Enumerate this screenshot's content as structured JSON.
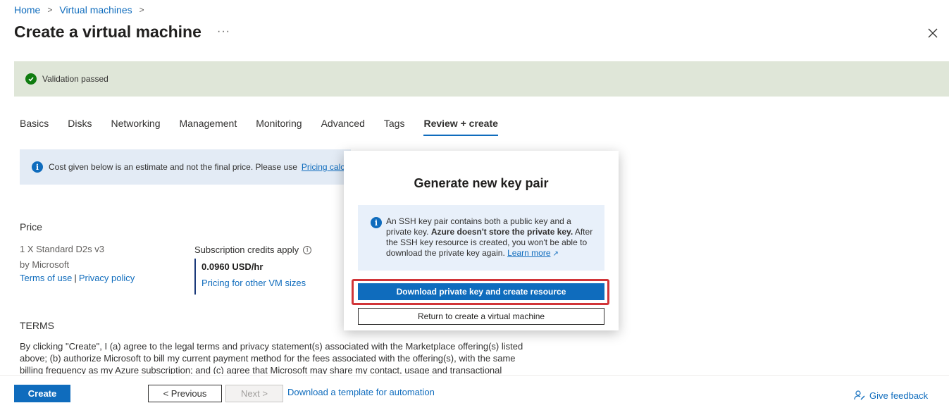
{
  "breadcrumb": {
    "home": "Home",
    "virtual_machines": "Virtual machines"
  },
  "header": {
    "title": "Create a virtual machine",
    "more": "···"
  },
  "validation": {
    "text": "Validation passed"
  },
  "tabs": [
    {
      "label": "Basics"
    },
    {
      "label": "Disks"
    },
    {
      "label": "Networking"
    },
    {
      "label": "Management"
    },
    {
      "label": "Monitoring"
    },
    {
      "label": "Advanced"
    },
    {
      "label": "Tags"
    },
    {
      "label": "Review + create"
    }
  ],
  "info_bar": {
    "text": "Cost given below is an estimate and not the final price. Please use",
    "link": "Pricing calcu"
  },
  "price": {
    "label": "Price",
    "vm_size": "1 X Standard D2s v3",
    "publisher": "by Microsoft",
    "terms_link": "Terms of use",
    "privacy_link": "Privacy policy",
    "separator": "|",
    "subscription_credits": "Subscription credits apply",
    "value": "0.0960 USD/hr",
    "other_sizes_link": "Pricing for other VM sizes"
  },
  "terms": {
    "label": "TERMS",
    "text": "By clicking \"Create\", I (a) agree to the legal terms and privacy statement(s) associated with the Marketplace offering(s) listed above; (b) authorize Microsoft to bill my current payment method for the fees associated with the offering(s), with the same billing frequency as my Azure subscription; and (c) agree that Microsoft may share my contact, usage and transactional"
  },
  "footer": {
    "create": "Create",
    "previous": "< Previous",
    "next": "Next >",
    "template_link": "Download a template for automation",
    "feedback": "Give feedback"
  },
  "modal": {
    "title": "Generate new key pair",
    "info_part1": "An SSH key pair contains both a public key and a private key. ",
    "info_bold": "Azure doesn't store the private key.",
    "info_part2": " After the SSH key resource is created, you won't be able to download the private key again. ",
    "learn_more": "Learn more",
    "download_button": "Download private key and create resource",
    "return_button": "Return to create a virtual machine"
  },
  "colors": {
    "accent": "#0f6cbd",
    "success": "#107c10",
    "highlight": "#d13438"
  }
}
